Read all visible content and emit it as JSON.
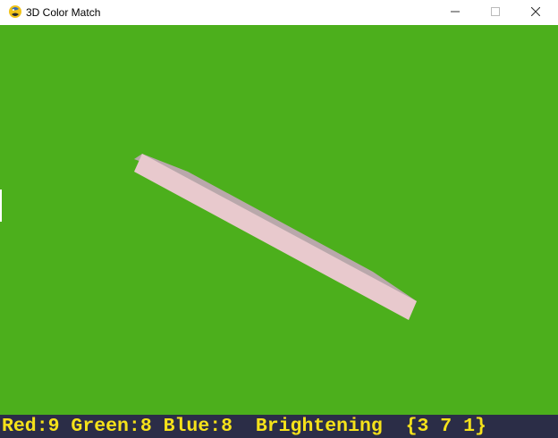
{
  "window": {
    "title": "3D Color Match",
    "icon": "python-snake-icon"
  },
  "controls": {
    "minimize": "minimize-icon",
    "maximize": "maximize-icon",
    "close": "close-icon"
  },
  "scene": {
    "background_color": "#4caf1c",
    "object": {
      "name": "tilted-slab",
      "face_color": "#e8c9cd",
      "side_color": "#b9a8ab"
    }
  },
  "status": {
    "text": "Red:9 Green:8 Blue:8  Brightening  {3 7 1}",
    "text_color": "#f5e21a",
    "background_color": "#2b2d47"
  }
}
